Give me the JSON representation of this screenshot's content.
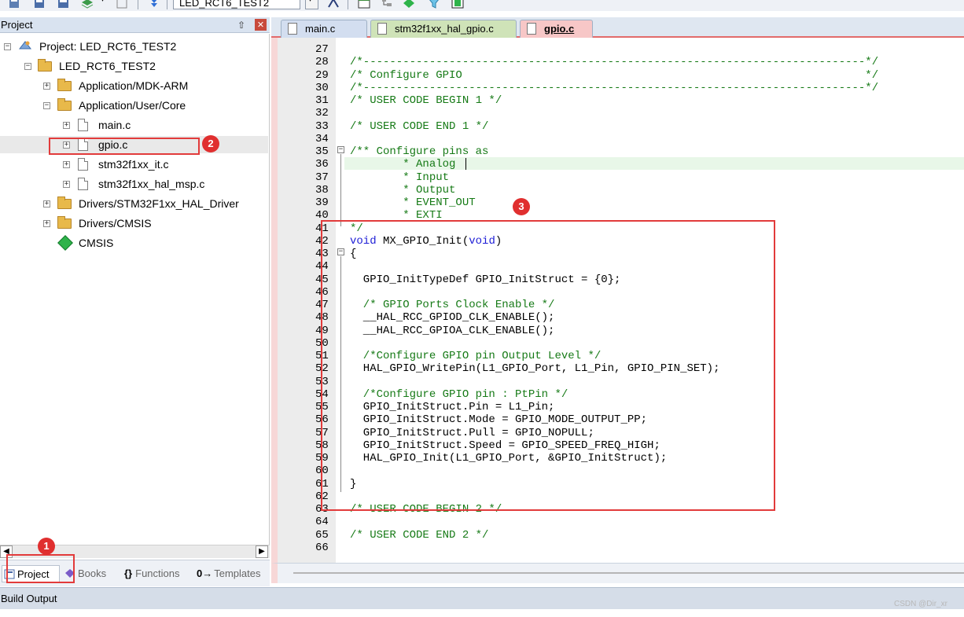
{
  "toolbar": {
    "target_name": "LED_RCT6_TEST2",
    "icons": [
      "build-icon",
      "save-icon",
      "save-all-icon",
      "layers-icon",
      "copy-icon",
      "download-icon",
      "compass-icon",
      "window-icon",
      "tree-icon",
      "diamond-icon",
      "funnel-icon",
      "chip-icon"
    ]
  },
  "project_panel": {
    "title": "Project",
    "pin_glyph": "⬆",
    "close_glyph": "✕",
    "tree": [
      {
        "label": "Project: LED_RCT6_TEST2",
        "icon": "project-icon",
        "expander": "−"
      },
      {
        "label": "LED_RCT6_TEST2",
        "icon": "target-folder-icon",
        "expander": "−"
      },
      {
        "label": "Application/MDK-ARM",
        "icon": "folder-icon",
        "expander": "+"
      },
      {
        "label": "Application/User/Core",
        "icon": "folder-icon",
        "expander": "−"
      },
      {
        "label": "main.c",
        "icon": "file-icon",
        "expander": "+"
      },
      {
        "label": "gpio.c",
        "icon": "file-icon",
        "expander": "+"
      },
      {
        "label": "stm32f1xx_it.c",
        "icon": "file-icon",
        "expander": "+"
      },
      {
        "label": "stm32f1xx_hal_msp.c",
        "icon": "file-icon",
        "expander": "+"
      },
      {
        "label": "Drivers/STM32F1xx_HAL_Driver",
        "icon": "folder-icon",
        "expander": "+"
      },
      {
        "label": "Drivers/CMSIS",
        "icon": "folder-icon",
        "expander": "+"
      },
      {
        "label": "CMSIS",
        "icon": "cmsis-icon",
        "expander": ""
      }
    ],
    "bottom_tabs": [
      {
        "label": "Project",
        "icon": "project-tab-icon",
        "active": true
      },
      {
        "label": "Books",
        "icon": "books-icon",
        "active": false
      },
      {
        "label": "Functions",
        "icon": "functions-icon",
        "active": false
      },
      {
        "label": "Templates",
        "icon": "templates-icon",
        "active": false
      }
    ],
    "functions_glyph": "{}",
    "templates_glyph": "0→",
    "scroll_left_glyph": "◀",
    "scroll_right_glyph": "▶"
  },
  "editor": {
    "tabs": [
      {
        "label": "main.c",
        "active": false
      },
      {
        "label": "stm32f1xx_hal_gpio.c",
        "active": false
      },
      {
        "label": "gpio.c",
        "active": true
      }
    ],
    "lines": [
      {
        "n": "27",
        "text": ""
      },
      {
        "n": "28",
        "text": "/*----------------------------------------------------------------------------*/",
        "type": "cm"
      },
      {
        "n": "29",
        "text": "/* Configure GPIO                                                             */",
        "type": "cm"
      },
      {
        "n": "30",
        "text": "/*----------------------------------------------------------------------------*/",
        "type": "cm"
      },
      {
        "n": "31",
        "text": "/* USER CODE BEGIN 1 */",
        "type": "cm"
      },
      {
        "n": "32",
        "text": ""
      },
      {
        "n": "33",
        "text": "/* USER CODE END 1 */",
        "type": "cm"
      },
      {
        "n": "34",
        "text": ""
      },
      {
        "n": "35",
        "text": "/** Configure pins as",
        "type": "cm"
      },
      {
        "n": "36",
        "text": "        * Analog",
        "type": "cm"
      },
      {
        "n": "37",
        "text": "        * Input",
        "type": "cm"
      },
      {
        "n": "38",
        "text": "        * Output",
        "type": "cm"
      },
      {
        "n": "39",
        "text": "        * EVENT_OUT",
        "type": "cm"
      },
      {
        "n": "40",
        "text": "        * EXTI",
        "type": "cm"
      },
      {
        "n": "41",
        "text": "*/",
        "type": "cm"
      },
      {
        "n": "42",
        "text": "void MX_GPIO_Init(void)",
        "type": "fn"
      },
      {
        "n": "43",
        "text": "{"
      },
      {
        "n": "44",
        "text": ""
      },
      {
        "n": "45",
        "text": "  GPIO_InitTypeDef GPIO_InitStruct = {0};"
      },
      {
        "n": "46",
        "text": ""
      },
      {
        "n": "47",
        "text": "  /* GPIO Ports Clock Enable */",
        "type": "cm"
      },
      {
        "n": "48",
        "text": "  __HAL_RCC_GPIOD_CLK_ENABLE();"
      },
      {
        "n": "49",
        "text": "  __HAL_RCC_GPIOA_CLK_ENABLE();"
      },
      {
        "n": "50",
        "text": ""
      },
      {
        "n": "51",
        "text": "  /*Configure GPIO pin Output Level */",
        "type": "cm"
      },
      {
        "n": "52",
        "text": "  HAL_GPIO_WritePin(L1_GPIO_Port, L1_Pin, GPIO_PIN_SET);"
      },
      {
        "n": "53",
        "text": ""
      },
      {
        "n": "54",
        "text": "  /*Configure GPIO pin : PtPin */",
        "type": "cm"
      },
      {
        "n": "55",
        "text": "  GPIO_InitStruct.Pin = L1_Pin;"
      },
      {
        "n": "56",
        "text": "  GPIO_InitStruct.Mode = GPIO_MODE_OUTPUT_PP;"
      },
      {
        "n": "57",
        "text": "  GPIO_InitStruct.Pull = GPIO_NOPULL;"
      },
      {
        "n": "58",
        "text": "  GPIO_InitStruct.Speed = GPIO_SPEED_FREQ_HIGH;"
      },
      {
        "n": "59",
        "text": "  HAL_GPIO_Init(L1_GPIO_Port, &GPIO_InitStruct);"
      },
      {
        "n": "60",
        "text": ""
      },
      {
        "n": "61",
        "text": "}"
      },
      {
        "n": "62",
        "text": ""
      },
      {
        "n": "63",
        "text": "/* USER CODE BEGIN 2 */",
        "type": "cm"
      },
      {
        "n": "64",
        "text": ""
      },
      {
        "n": "65",
        "text": "/* USER CODE END 2 */",
        "type": "cm"
      },
      {
        "n": "66",
        "text": ""
      }
    ],
    "fold_glyph": "−"
  },
  "annotations": {
    "badges": [
      "1",
      "2",
      "3"
    ],
    "color": "#e23b3b"
  },
  "build_output": {
    "label": "Build Output"
  },
  "watermark": "CSDN @Dir_xr",
  "colors": {
    "comment": "#167a16",
    "keyword": "#1d1dd6",
    "active_tab": "#f7c7c7",
    "highlight_line": "#e8f7e8"
  }
}
